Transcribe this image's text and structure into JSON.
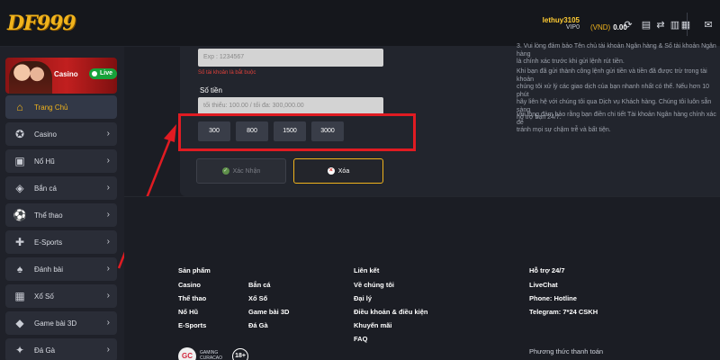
{
  "header": {
    "logo": "DF999",
    "username": "lethuy3105",
    "vip": "VIP0",
    "currency": "(VND)",
    "balance": "0.00"
  },
  "sidebar": {
    "banner": {
      "label": "Casino",
      "badge": "Live"
    },
    "items": [
      {
        "label": "Trang Chủ",
        "icon": "home-icon",
        "active": true
      },
      {
        "label": "Casino",
        "icon": "casino-chip-icon"
      },
      {
        "label": "Nổ Hũ",
        "icon": "slot-machine-icon"
      },
      {
        "label": "Bắn cá",
        "icon": "fish-icon"
      },
      {
        "label": "Thể thao",
        "icon": "soccer-ball-icon"
      },
      {
        "label": "E-Sports",
        "icon": "gamepad-icon"
      },
      {
        "label": "Đánh bài",
        "icon": "cards-icon"
      },
      {
        "label": "Xổ Số",
        "icon": "lottery-icon"
      },
      {
        "label": "Game bài 3D",
        "icon": "cube-icon"
      },
      {
        "label": "Đá Gà",
        "icon": "rooster-icon"
      }
    ]
  },
  "form": {
    "account_placeholder": "Exp : 1234567",
    "error": "Số tài khoản là bắt buộc",
    "amount_label": "Số tiền",
    "amount_placeholder": "tối thiểu: 100.00 / tối đa: 300,000.00",
    "quick_amounts": [
      "300",
      "800",
      "1500",
      "3000"
    ],
    "confirm_label": "Xác Nhận",
    "clear_label": "Xóa"
  },
  "info": {
    "p1": "3. Vui lòng đảm bảo Tên chủ tài khoản Ngân hàng & Số tài khoản Ngân hàng\nlà chính xác trước khi gửi lệnh rút tiền.",
    "p2": "Khi bạn đã gửi thành công lệnh gửi tiền và tiền đã được trừ trong tài khoản\nchúng tôi xử lý các giao dịch của bạn nhanh nhất có thể. Nếu hơn 10 phút\nhãy liên hệ với chúng tôi qua Dịch vụ Khách hàng. Chúng tôi luôn sẵn sàng\nhỗ trợ bạn 24/7.",
    "p3": "Vui lòng đảm bảo rằng bạn điền chi tiết Tài khoản Ngân hàng chính xác để\ntránh mọi sự chậm trễ và bất tiện."
  },
  "footer": {
    "products_title": "Sản phẩm",
    "products_col1": [
      "Casino",
      "Thể thao",
      "Nổ Hũ",
      "E-Sports"
    ],
    "products_col2": [
      "Bắn cá",
      "Xổ Số",
      "Game bài 3D",
      "Đá Gà"
    ],
    "links_title": "Liên kết",
    "links": [
      "Về chúng tôi",
      "Đại lý",
      "Điều khoản & điều kiện",
      "Khuyến mãi",
      "FAQ"
    ],
    "support_title": "Hỗ trợ 24/7",
    "support": [
      "LiveChat",
      "Phone: Hotline",
      "Telegram: 7*24 CSKH"
    ],
    "payment_title": "Phương thức thanh toán",
    "gc_logo": "GC",
    "gc_text": "GAMING\nCURACAO",
    "age": "18+"
  },
  "colors": {
    "accent": "#f0b31c",
    "highlight": "#e01b22",
    "background": "#1b1d24",
    "panel": "#22252d"
  }
}
